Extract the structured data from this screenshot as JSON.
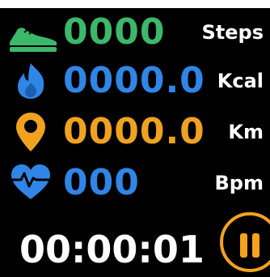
{
  "colors": {
    "background": "#000000",
    "steps": "#3cb86a",
    "kcal": "#2f86e6",
    "km": "#f0a21e",
    "bpm": "#2f86e6",
    "text": "#ffffff",
    "pause": "#f5a21c"
  },
  "metrics": {
    "steps": {
      "icon": "shoe-icon",
      "value": "0000",
      "unit": "Steps"
    },
    "kcal": {
      "icon": "flame-icon",
      "value": "0000.0",
      "unit": "Kcal"
    },
    "km": {
      "icon": "location-pin-icon",
      "value": "0000.0",
      "unit": "Km"
    },
    "bpm": {
      "icon": "heart-rate-icon",
      "value": "000",
      "unit": "Bpm"
    }
  },
  "timer": {
    "value": "00:00:01"
  },
  "controls": {
    "pause_icon": "pause-icon"
  }
}
